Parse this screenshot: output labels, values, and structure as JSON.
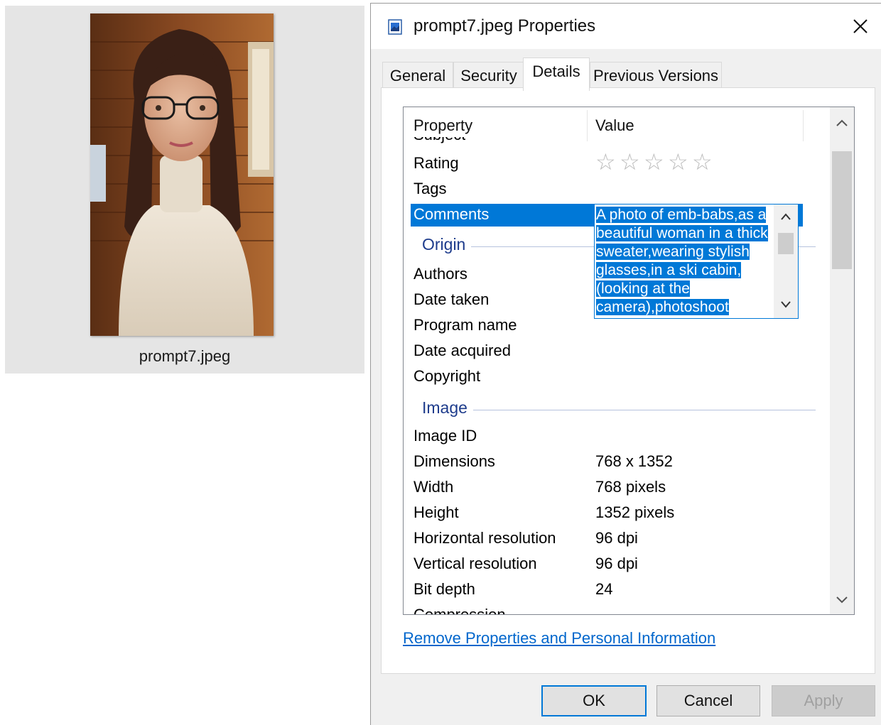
{
  "explorer": {
    "file_name": "prompt7.jpeg"
  },
  "dialog": {
    "title": "prompt7.jpeg Properties",
    "tabs": [
      {
        "label": "General"
      },
      {
        "label": "Security"
      },
      {
        "label": "Details"
      },
      {
        "label": "Previous Versions"
      }
    ],
    "active_tab": "Details",
    "columns": {
      "property": "Property",
      "value": "Value"
    },
    "partial_top_row": "Subject",
    "rows": {
      "rating": {
        "name": "Rating",
        "stars": 0,
        "max_stars": 5
      },
      "tags": {
        "name": "Tags",
        "value": ""
      },
      "comments": {
        "name": "Comments",
        "value_lines": [
          "A photo of emb-babs,as a",
          "beautiful woman in a thick",
          "sweater,wearing stylish",
          "glasses,in a ski cabin,",
          "(looking at the",
          "camera),photoshoot"
        ]
      }
    },
    "groups": {
      "origin": {
        "label": "Origin",
        "items": [
          {
            "name": "Authors",
            "value": ""
          },
          {
            "name": "Date taken",
            "value": ""
          },
          {
            "name": "Program name",
            "value": ""
          },
          {
            "name": "Date acquired",
            "value": ""
          },
          {
            "name": "Copyright",
            "value": ""
          }
        ]
      },
      "image": {
        "label": "Image",
        "items": [
          {
            "name": "Image ID",
            "value": ""
          },
          {
            "name": "Dimensions",
            "value": "768 x 1352"
          },
          {
            "name": "Width",
            "value": "768 pixels"
          },
          {
            "name": "Height",
            "value": "1352 pixels"
          },
          {
            "name": "Horizontal resolution",
            "value": "96 dpi"
          },
          {
            "name": "Vertical resolution",
            "value": "96 dpi"
          },
          {
            "name": "Bit depth",
            "value": "24"
          }
        ]
      }
    },
    "partial_bottom_row": "Compression",
    "remove_link": "Remove Properties and Personal Information",
    "buttons": {
      "ok": "OK",
      "cancel": "Cancel",
      "apply": "Apply"
    },
    "colors": {
      "selection": "#0078d7",
      "group_label": "#1e3c8c",
      "link": "#0066cc"
    }
  }
}
